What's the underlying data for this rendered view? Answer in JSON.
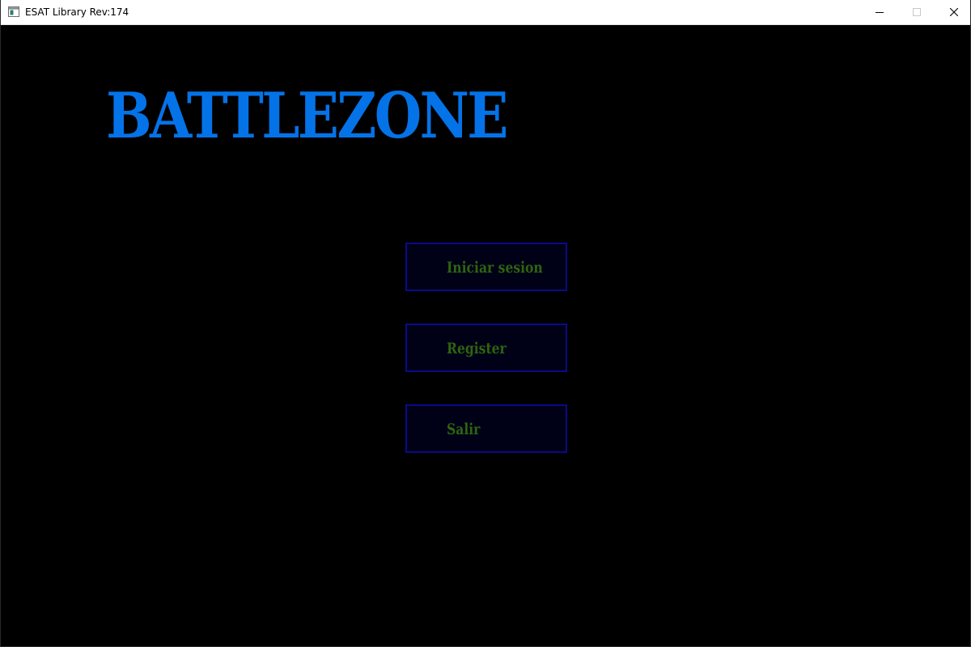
{
  "window": {
    "title": "ESAT Library Rev:174",
    "controls": {
      "minimize_icon": "minimize-icon",
      "maximize_icon": "maximize-icon",
      "close_icon": "close-icon"
    }
  },
  "game": {
    "title": "BATTLEZONE",
    "title_color": "#0473e8",
    "label_color": "#2e6410",
    "button_border_color": "#0a0a8a",
    "background_color": "#000000"
  },
  "menu": {
    "buttons": [
      {
        "label": "Iniciar sesion"
      },
      {
        "label": "Register"
      },
      {
        "label": "Salir"
      }
    ]
  }
}
